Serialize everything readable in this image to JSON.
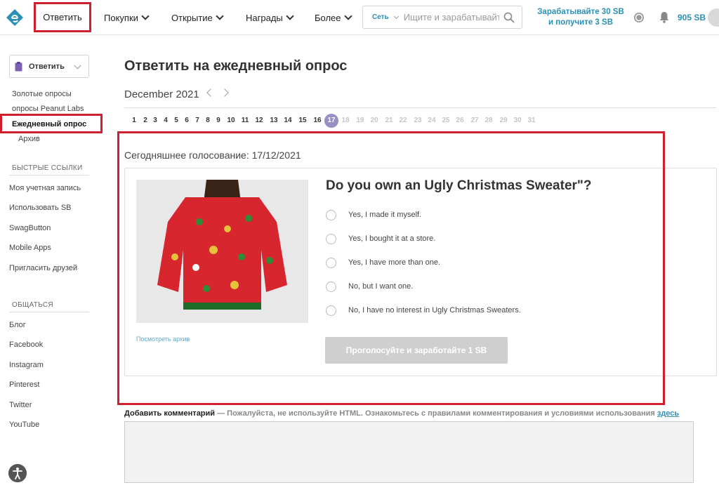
{
  "topbar": {
    "answer_label": "Ответить",
    "nav": [
      {
        "label": "Покупки"
      },
      {
        "label": "Открытие"
      },
      {
        "label": "Награды"
      },
      {
        "label": "Более"
      }
    ],
    "search": {
      "scope": "Сеть",
      "placeholder": "Ищите и зарабатывайте"
    },
    "promo_line1": "Зарабатывайте 30 SB",
    "promo_line2": "и получите 3 SB",
    "balance": "905 SB",
    "brand_color": "#2c8fb5",
    "highlight_color": "#d0202f"
  },
  "sidebar": {
    "dropdown_label": "Ответить",
    "links": [
      {
        "label": "Золотые опросы"
      },
      {
        "label": "опросы Peanut Labs"
      },
      {
        "label": "Ежедневный опрос"
      },
      {
        "label": "Архив"
      }
    ],
    "quick_header": "БЫСТРЫЕ ССЫЛКИ",
    "quick_links": [
      {
        "label": "Моя учетная запись"
      },
      {
        "label": "Использовать SB"
      },
      {
        "label": "SwagButton"
      },
      {
        "label": "Mobile Apps"
      },
      {
        "label": "Пригласить друзей"
      }
    ],
    "social_header": "ОБЩАТЬСЯ",
    "social_links": [
      {
        "label": "Блог"
      },
      {
        "label": "Facebook"
      },
      {
        "label": "Instagram"
      },
      {
        "label": "Pinterest"
      },
      {
        "label": "Twitter"
      },
      {
        "label": "YouTube"
      }
    ]
  },
  "main": {
    "title": "Ответить на ежедневный опрос",
    "month": "December 2021",
    "days": [
      "1",
      "2",
      "3",
      "4",
      "5",
      "6",
      "7",
      "8",
      "9",
      "10",
      "11",
      "12",
      "13",
      "14",
      "15",
      "16",
      "17",
      "18",
      "19",
      "20",
      "21",
      "22",
      "23",
      "24",
      "25",
      "26",
      "27",
      "28",
      "29",
      "30",
      "31"
    ],
    "today": "17",
    "poll_date": "Сегодняшнее голосование: 17/12/2021",
    "question": "Do you own an Ugly Christmas Sweater\"?",
    "options": [
      {
        "label": "Yes, I made it myself."
      },
      {
        "label": "Yes, I bought it at a store."
      },
      {
        "label": "Yes, I have more than one."
      },
      {
        "label": "No, but I want one."
      },
      {
        "label": "No, I have no interest in Ugly Christmas Sweaters."
      }
    ],
    "archive_link": "Посмотреть архив",
    "vote_button": "Проголосуйте и заработайте 1 SB",
    "comment": {
      "label": "Добавить комментарий",
      "note": " — Пожалуйста, не используйте HTML. Ознакомьтесь с правилами комментирования и условиями использования ",
      "link": "здесь"
    }
  }
}
